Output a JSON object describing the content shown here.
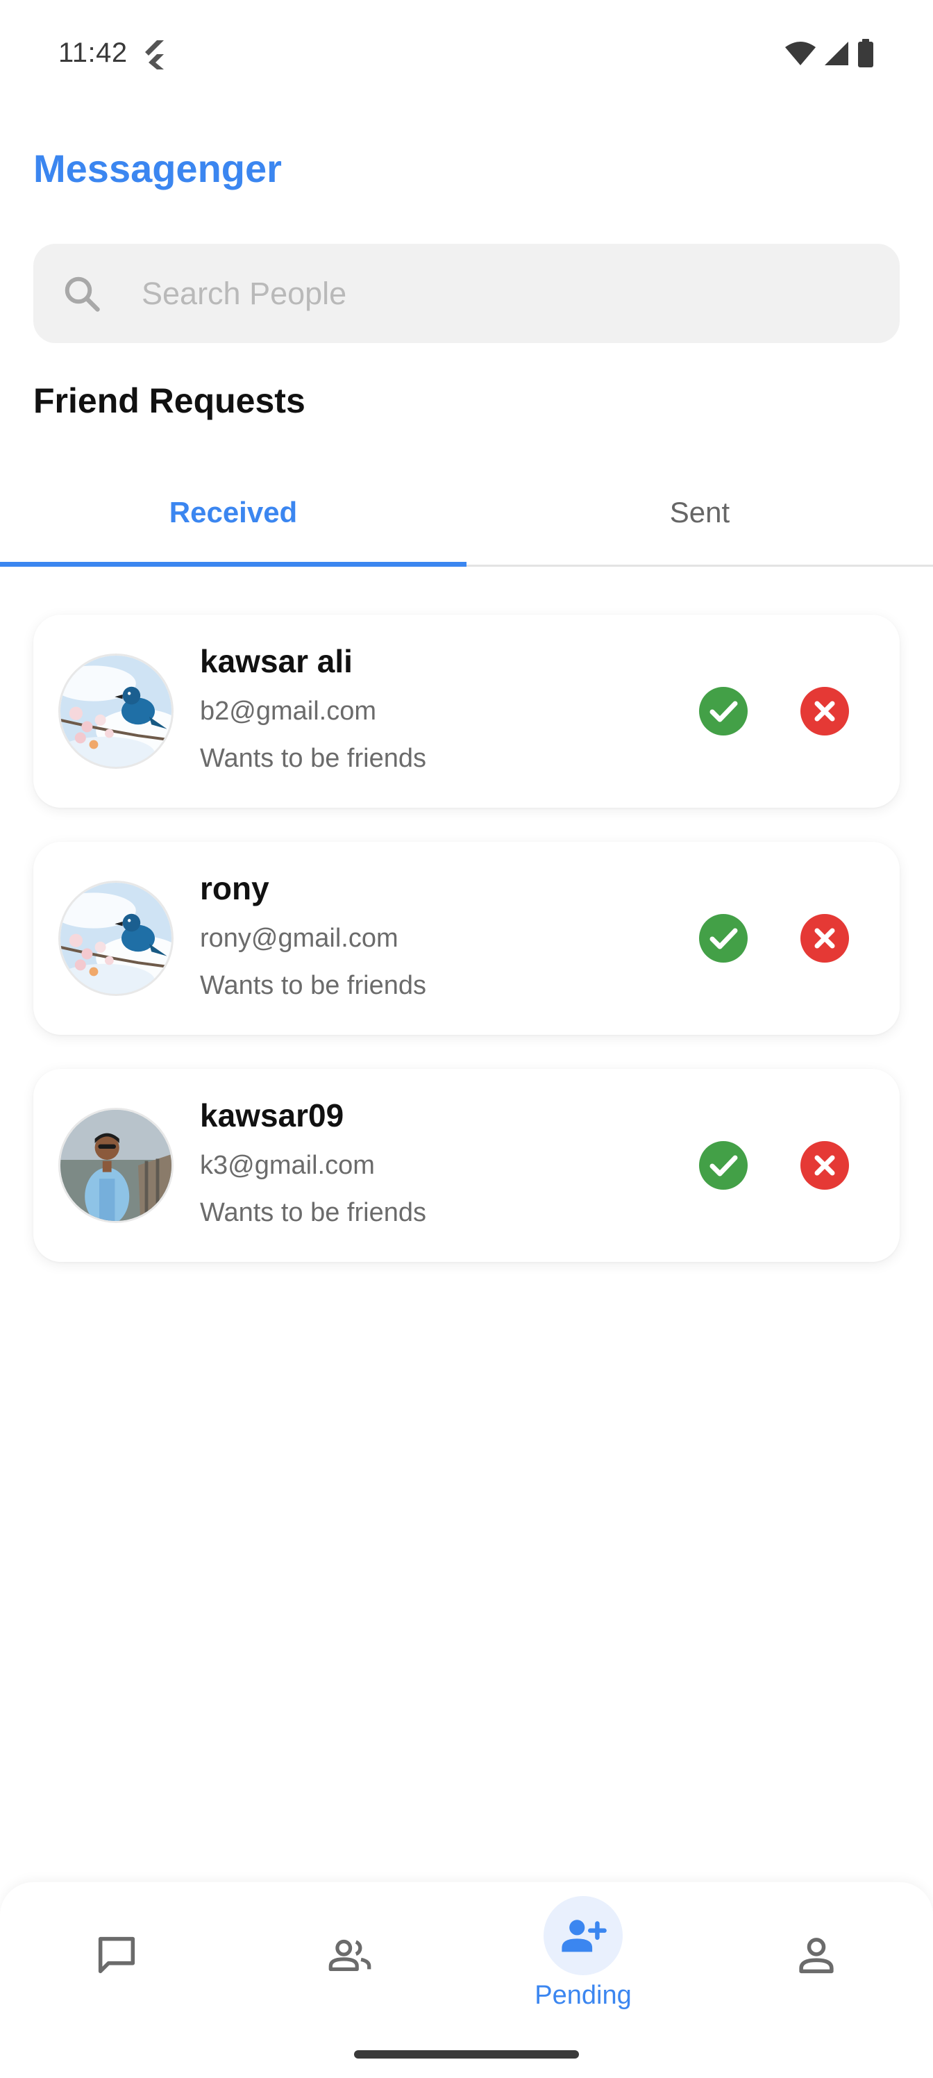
{
  "status_bar": {
    "time": "11:42"
  },
  "app": {
    "title": "Messagenger"
  },
  "search": {
    "placeholder": "Search People",
    "value": ""
  },
  "section": {
    "title": "Friend Requests"
  },
  "tabs": [
    {
      "label": "Received",
      "active": true
    },
    {
      "label": "Sent",
      "active": false
    }
  ],
  "requests": [
    {
      "name": "kawsar ali",
      "email": "b2@gmail.com",
      "status": "Wants to be friends",
      "avatar": "bird-photo"
    },
    {
      "name": "rony",
      "email": "rony@gmail.com",
      "status": "Wants to be friends",
      "avatar": "bird-photo"
    },
    {
      "name": "kawsar09",
      "email": "k3@gmail.com",
      "status": "Wants to be friends",
      "avatar": "person-photo"
    }
  ],
  "bottom_nav": {
    "items": [
      {
        "icon": "chat-icon",
        "label": ""
      },
      {
        "icon": "people-icon",
        "label": ""
      },
      {
        "icon": "person-add-icon",
        "label": "Pending",
        "active": true
      },
      {
        "icon": "profile-icon",
        "label": ""
      }
    ]
  },
  "colors": {
    "accent": "#3b86f0",
    "accept": "#43a047",
    "reject": "#e53935",
    "search_bg": "#f1f1f1"
  }
}
